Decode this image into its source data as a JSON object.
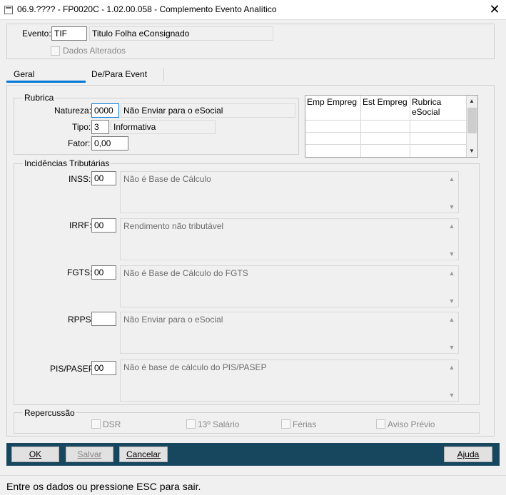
{
  "window": {
    "title": "06.9.???? - FP0020C - 1.02.00.058 - Complemento Evento Analítico",
    "close_symbol": "✕"
  },
  "header": {
    "evento_label": "Evento:",
    "evento_code": "TIF",
    "evento_description": "Titulo Folha  eConsignado",
    "dados_alterados_label": "Dados Alterados"
  },
  "tabs": [
    {
      "label": "Geral",
      "active": true
    },
    {
      "label": "De/Para Event",
      "active": false
    }
  ],
  "rubrica": {
    "title": "Rubrica",
    "natureza_label": "Natureza:",
    "natureza_value": "0000",
    "natureza_desc": "Não Enviar para o eSocial",
    "tipo_label": "Tipo:",
    "tipo_value": "3",
    "tipo_desc": "Informativa",
    "fator_label": "Fator:",
    "fator_value": "0,00"
  },
  "grid": {
    "columns": [
      "Emp Empreg",
      "Est Empreg",
      "Rubrica eSocial"
    ],
    "rows": [
      [
        "",
        "",
        ""
      ],
      [
        "",
        "",
        ""
      ],
      [
        "",
        "",
        ""
      ]
    ]
  },
  "incidencias": {
    "title": "Incidências Tributárias",
    "items": [
      {
        "label": "INSS:",
        "code": "00",
        "desc": "Não é Base de Cálculo"
      },
      {
        "label": "IRRF:",
        "code": "00",
        "desc": "Rendimento não tributável"
      },
      {
        "label": "FGTS:",
        "code": "00",
        "desc": "Não é Base de Cálculo do FGTS"
      },
      {
        "label": "RPPS:",
        "code": "",
        "desc": "Não Enviar para o eSocial"
      },
      {
        "label": "PIS/PASEP:",
        "code": "00",
        "desc": "Não é base de cálculo do PIS/PASEP"
      }
    ]
  },
  "repercussao": {
    "title": "Repercussão",
    "options": [
      "DSR",
      "13º Salário",
      "Férias",
      "Aviso Prévio"
    ]
  },
  "buttons": {
    "ok": "OK",
    "salvar": "Salvar",
    "cancelar": "Cancelar",
    "ajuda": "Ajuda"
  },
  "status": {
    "message": "Entre os dados ou pressione ESC para sair."
  },
  "colors": {
    "accent": "#0078d7",
    "footer_bar": "#17465f"
  }
}
